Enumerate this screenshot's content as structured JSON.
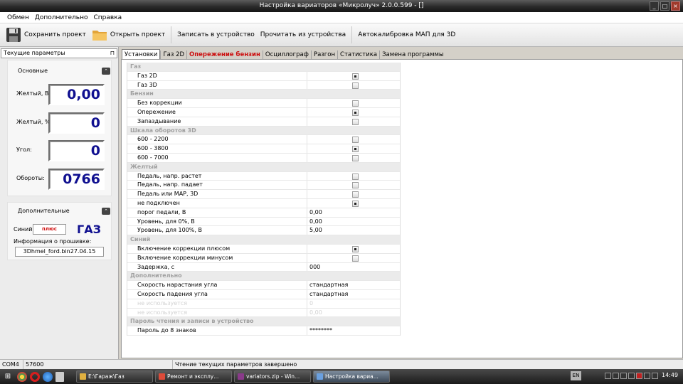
{
  "window": {
    "title": "Настройка вариаторов «Микролуч» 2.0.0.599 - []"
  },
  "menu": [
    "Обмен",
    "Дополнительно",
    "Справка"
  ],
  "toolbar": {
    "save": "Сохранить проект",
    "open": "Открыть проект",
    "write": "Записать в устройство",
    "read": "Прочитать из устройства",
    "autocal": "Автокалибровка МАП для 3D"
  },
  "left_panel": {
    "header": "Текущие параметры",
    "main_group": {
      "title": "Основные",
      "rows": [
        {
          "label": "Желтый, В:",
          "value": "0,00"
        },
        {
          "label": "Желтый, %:",
          "value": "0"
        },
        {
          "label": "Угол:",
          "value": "0"
        },
        {
          "label": "Обороты:",
          "value": "0766"
        }
      ]
    },
    "extra_group": {
      "title": "Дополнительные",
      "blue_label": "Синий:",
      "blue_value": "плюс",
      "fuel": "ГАЗ",
      "firmware_label": "Информация о прошивке:",
      "firmware_value": "3Dhmel_ford.bin27.04.15"
    }
  },
  "tabs": [
    {
      "label": "Установки",
      "active": true,
      "red": false
    },
    {
      "label": "Газ 2D",
      "active": false,
      "red": false
    },
    {
      "label": "Опережение бензин",
      "active": false,
      "red": true
    },
    {
      "label": "Осциллограф",
      "active": false,
      "red": false
    },
    {
      "label": "Разгон",
      "active": false,
      "red": false
    },
    {
      "label": "Статистика",
      "active": false,
      "red": false
    },
    {
      "label": "Замена программы",
      "active": false,
      "red": false
    }
  ],
  "settings": [
    {
      "type": "category",
      "label": "Газ"
    },
    {
      "type": "check",
      "label": "Газ 2D",
      "checked": true
    },
    {
      "type": "check",
      "label": "Газ 3D",
      "checked": false
    },
    {
      "type": "category",
      "label": "Бензин"
    },
    {
      "type": "check",
      "label": "Без коррекции",
      "checked": false
    },
    {
      "type": "check",
      "label": "Опережение",
      "checked": true
    },
    {
      "type": "check",
      "label": "Запаздывание",
      "checked": false
    },
    {
      "type": "category",
      "label": "Шкала оборотов 3D"
    },
    {
      "type": "check",
      "label": "600 - 2200",
      "checked": false
    },
    {
      "type": "check",
      "label": "600 - 3800",
      "checked": true
    },
    {
      "type": "check",
      "label": "600 - 7000",
      "checked": false
    },
    {
      "type": "category",
      "label": "Желтый"
    },
    {
      "type": "check",
      "label": "Педаль, напр. растет",
      "checked": false
    },
    {
      "type": "check",
      "label": "Педаль, напр. падает",
      "checked": false
    },
    {
      "type": "check",
      "label": "Педаль или MAP, 3D",
      "checked": false
    },
    {
      "type": "check",
      "label": "не подключен",
      "checked": true
    },
    {
      "type": "value",
      "label": "порог педали, В",
      "value": "0,00"
    },
    {
      "type": "value",
      "label": "Уровень, для 0%, В",
      "value": "0,00"
    },
    {
      "type": "value",
      "label": "Уровень, для 100%, В",
      "value": "5,00"
    },
    {
      "type": "category",
      "label": "Синий"
    },
    {
      "type": "check",
      "label": "Включение коррекции плюсом",
      "checked": true
    },
    {
      "type": "check",
      "label": "Включение коррекции минусом",
      "checked": false
    },
    {
      "type": "value",
      "label": "Задержка, с",
      "value": "000"
    },
    {
      "type": "category",
      "label": "Дополнительно"
    },
    {
      "type": "value",
      "label": "Скорость нарастания угла",
      "value": "стандартная"
    },
    {
      "type": "value",
      "label": "Скорость падения угла",
      "value": "стандартная"
    },
    {
      "type": "disabled",
      "label": "не используется",
      "value": "0"
    },
    {
      "type": "disabled",
      "label": "не используется",
      "value": "0,00"
    },
    {
      "type": "category",
      "label": "Пароль чтения и записи в устройство"
    },
    {
      "type": "value",
      "label": "Пароль до 8 знаков",
      "value": "********"
    }
  ],
  "status": {
    "port": "COM4",
    "baud": "57600",
    "message": "Чтение текущих параметров завершено"
  },
  "taskbar": {
    "tasks": [
      {
        "label": "E:\\Гараж\\Газ",
        "color": "#e0b040",
        "active": false
      },
      {
        "label": "Ремонт и эксплу...",
        "color": "#dd4b39",
        "active": false
      },
      {
        "label": "variators.zip - Win...",
        "color": "#8a3a8a",
        "active": false
      },
      {
        "label": "Настройка вариа...",
        "color": "#6aa0e0",
        "active": true
      }
    ],
    "lang": "EN",
    "clock": "14:49"
  },
  "colors": {
    "digit_blue": "#101090",
    "red_accent": "#cc1010",
    "accent_tab": "#cc1010"
  }
}
